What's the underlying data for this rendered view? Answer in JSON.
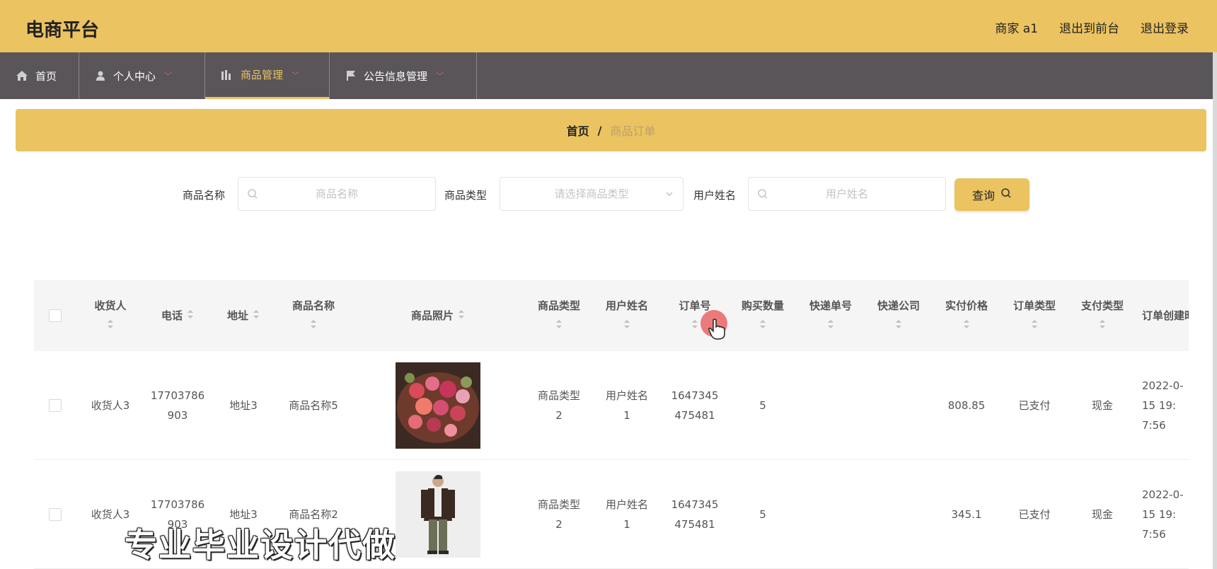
{
  "header": {
    "title": "电商平台",
    "user": "商家 a1",
    "to_front": "退出到前台",
    "logout": "退出登录"
  },
  "nav": {
    "items": [
      {
        "label": "首页",
        "icon": "home-icon"
      },
      {
        "label": "个人中心",
        "icon": "user-icon"
      },
      {
        "label": "商品管理",
        "icon": "chart-icon"
      },
      {
        "label": "公告信息管理",
        "icon": "flag-icon"
      }
    ],
    "active_index": 2
  },
  "breadcrumb": {
    "home": "首页",
    "separator": "/",
    "current": "商品订单"
  },
  "search": {
    "name_label": "商品名称",
    "name_placeholder": "商品名称",
    "type_label": "商品类型",
    "type_placeholder": "请选择商品类型",
    "user_label": "用户姓名",
    "user_placeholder": "用户姓名",
    "query_label": "查询"
  },
  "table": {
    "headers": [
      "收货人",
      "电话",
      "地址",
      "商品名称",
      "商品照片",
      "商品类型",
      "用户姓名",
      "订单号",
      "购买数量",
      "快递单号",
      "快递公司",
      "实付价格",
      "订单类型",
      "支付类型",
      "订单创建时间"
    ],
    "rows": [
      {
        "receiver": "收货人3",
        "phone": "17703786903",
        "address": "地址3",
        "goods_name": "商品名称5",
        "photo": "flower-bouquet-photo",
        "goods_type": "商品类型2",
        "user_name": "用户姓名1",
        "order_no": "1647345475481",
        "quantity": "5",
        "express_no": "",
        "express_company": "",
        "price": "808.85",
        "order_type": "已支付",
        "pay_type": "现金",
        "created": "2022-0-15 19:7:56"
      },
      {
        "receiver": "收货人3",
        "phone": "17703786903",
        "address": "地址3",
        "goods_name": "商品名称2",
        "photo": "man-in-jacket-photo",
        "goods_type": "商品类型2",
        "user_name": "用户姓名1",
        "order_no": "1647345475481",
        "quantity": "5",
        "express_no": "",
        "express_company": "",
        "price": "345.1",
        "order_type": "已支付",
        "pay_type": "现金",
        "created": "2022-0-15 19:7:56"
      }
    ]
  },
  "watermark": "专业毕业设计代做",
  "colors": {
    "accent": "#ebc361",
    "nav_bg": "#595559",
    "arrow": "#d86a6a"
  }
}
